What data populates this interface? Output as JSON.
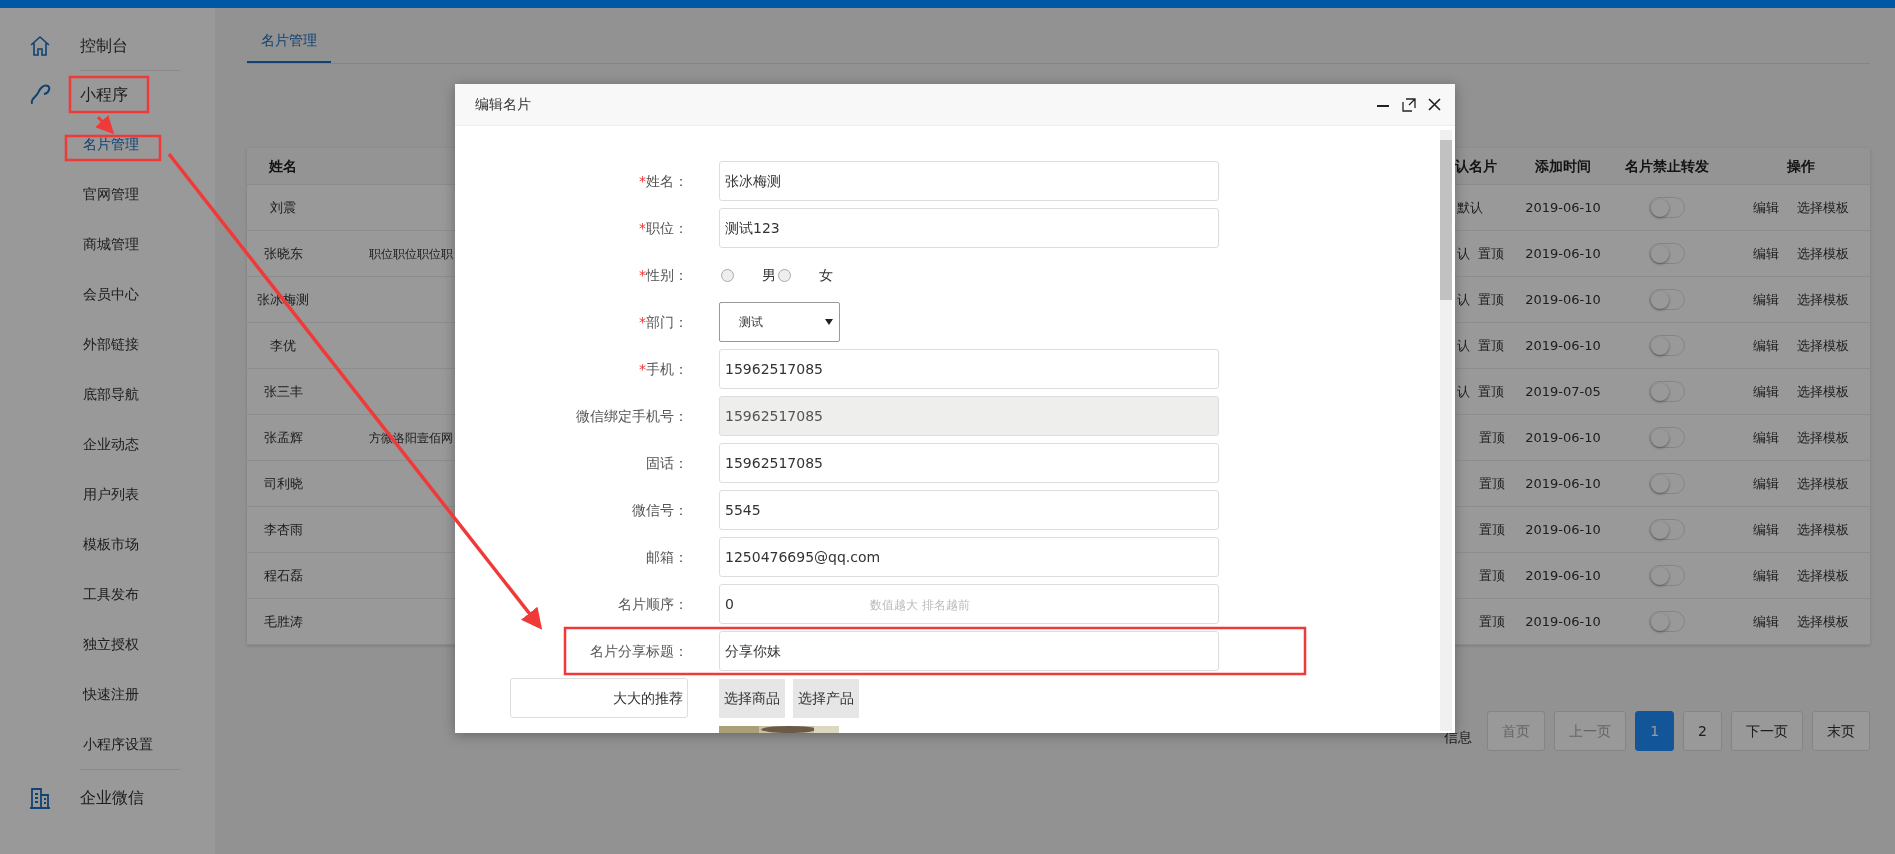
{
  "sidebar": {
    "sections": [
      {
        "label": "控制台"
      },
      {
        "label": "小程序",
        "children": [
          {
            "label": "名片管理",
            "selected": true
          },
          {
            "label": "官网管理",
            "selected": false
          },
          {
            "label": "商城管理",
            "selected": false
          },
          {
            "label": "会员中心",
            "selected": false
          },
          {
            "label": "外部链接",
            "selected": false
          },
          {
            "label": "底部导航",
            "selected": false
          },
          {
            "label": "企业动态",
            "selected": false
          },
          {
            "label": "用户列表",
            "selected": false
          },
          {
            "label": "模板市场",
            "selected": false
          },
          {
            "label": "工具发布",
            "selected": false
          },
          {
            "label": "独立授权",
            "selected": false
          },
          {
            "label": "快速注册",
            "selected": false
          },
          {
            "label": "小程序设置",
            "selected": false
          }
        ]
      },
      {
        "label": "企业微信"
      }
    ]
  },
  "tabs": [
    {
      "label": "名片管理",
      "selected": true
    }
  ],
  "table": {
    "columns": [
      "姓名",
      "认名片",
      "添加时间",
      "名片禁止转发",
      "操作"
    ],
    "rows": [
      {
        "name": "刘震",
        "column_3": "默认",
        "added": "2019-06-10",
        "forbid_forward": false,
        "actions": [
          "编辑",
          "选择模板"
        ]
      },
      {
        "name": "张晓东",
        "column_2": "职位职位职位职",
        "column_3": "认",
        "pin": "置顶",
        "added": "2019-06-10",
        "forbid_forward": false,
        "actions": [
          "编辑",
          "选择模板"
        ]
      },
      {
        "name": "张冰梅测",
        "column_3": "认",
        "pin": "置顶",
        "added": "2019-06-10",
        "forbid_forward": false,
        "actions": [
          "编辑",
          "选择模板"
        ]
      },
      {
        "name": "李优",
        "column_3": "认",
        "pin": "置顶",
        "added": "2019-06-10",
        "forbid_forward": false,
        "actions": [
          "编辑",
          "选择模板"
        ]
      },
      {
        "name": "张三丰",
        "column_3": "认",
        "pin": "置顶",
        "added": "2019-07-05",
        "forbid_forward": false,
        "actions": [
          "编辑",
          "选择模板"
        ]
      },
      {
        "name": "张孟辉",
        "column_2": "方微洛阳壹佰网",
        "pin": "置顶",
        "added": "2019-06-10",
        "forbid_forward": false,
        "actions": [
          "编辑",
          "选择模板"
        ]
      },
      {
        "name": "司利晓",
        "pin": "置顶",
        "added": "2019-06-10",
        "forbid_forward": false,
        "actions": [
          "编辑",
          "选择模板"
        ]
      },
      {
        "name": "李杏雨",
        "pin": "置顶",
        "added": "2019-06-10",
        "forbid_forward": false,
        "actions": [
          "编辑",
          "选择模板"
        ]
      },
      {
        "name": "程石磊",
        "pin": "置顶",
        "added": "2019-06-10",
        "forbid_forward": false,
        "actions": [
          "编辑",
          "选择模板"
        ]
      },
      {
        "name": "毛胜涛",
        "pin": "置顶",
        "added": "2019-06-10",
        "forbid_forward": false,
        "actions": [
          "编辑",
          "选择模板"
        ]
      }
    ]
  },
  "pagination": {
    "info": "信息",
    "buttons": [
      {
        "label": "首页",
        "selected": false,
        "disabled": true
      },
      {
        "label": "上一页",
        "selected": false,
        "disabled": true
      },
      {
        "label": "1",
        "selected": true,
        "disabled": false
      },
      {
        "label": "2",
        "selected": false,
        "disabled": false
      },
      {
        "label": "下一页",
        "selected": false,
        "disabled": false
      },
      {
        "label": "末页",
        "selected": false,
        "disabled": false
      }
    ]
  },
  "modal": {
    "title": "编辑名片",
    "fields": [
      {
        "kind": "input",
        "mark": "*",
        "label": "姓名：",
        "value": "张冰梅测",
        "disabled": false
      },
      {
        "kind": "input",
        "mark": "*",
        "label": "职位：",
        "value": "测试123",
        "disabled": false
      },
      {
        "kind": "radio",
        "mark": "*",
        "label": "性别：",
        "options": [
          {
            "label": "男",
            "selected": false
          },
          {
            "label": "女",
            "selected": false
          }
        ]
      },
      {
        "kind": "select",
        "mark": "*",
        "label": "部门：",
        "value": "测试"
      },
      {
        "kind": "input",
        "mark": "*",
        "label": "手机：",
        "value": "15962517085",
        "disabled": false
      },
      {
        "kind": "input",
        "label": "微信绑定手机号：",
        "value": "15962517085",
        "disabled": true
      },
      {
        "kind": "input",
        "label": "固话：",
        "value": "15962517085",
        "disabled": false
      },
      {
        "kind": "input",
        "label": "微信号：",
        "value": "5545",
        "disabled": false
      },
      {
        "kind": "input",
        "label": "邮箱：",
        "value": "1250476695@qq.com",
        "disabled": false
      },
      {
        "kind": "input",
        "label": "名片顺序：",
        "value": "0",
        "hint": "数值越大 排名越前",
        "disabled": false
      },
      {
        "kind": "input",
        "label": "名片分享标题：",
        "value": "分享你妹",
        "disabled": false
      }
    ],
    "recommend": {
      "value": "大大的推荐",
      "buttons": [
        "选择商品",
        "选择产品"
      ]
    }
  }
}
